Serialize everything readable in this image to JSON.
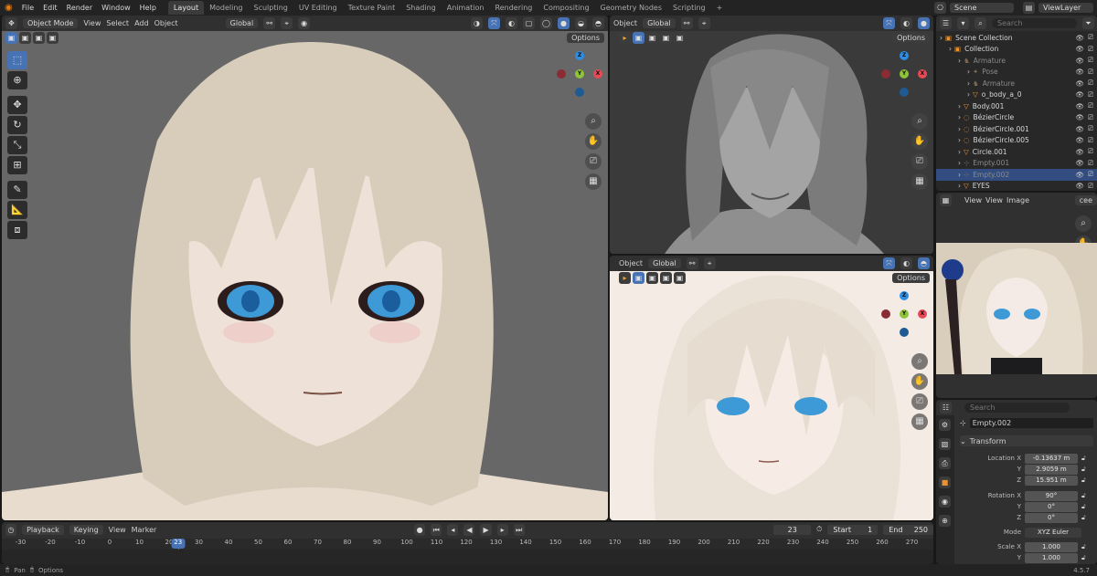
{
  "topbar": {
    "menus": [
      "File",
      "Edit",
      "Render",
      "Window",
      "Help"
    ],
    "workspaces": [
      "Layout",
      "Modeling",
      "Sculpting",
      "UV Editing",
      "Texture Paint",
      "Shading",
      "Animation",
      "Rendering",
      "Compositing",
      "Geometry Nodes",
      "Scripting"
    ],
    "add_tab": "+",
    "scene": "Scene",
    "view_layer": "ViewLayer"
  },
  "main_viewport": {
    "mode": "Object Mode",
    "menus": [
      "View",
      "Select",
      "Add",
      "Object"
    ],
    "orientation": "Global",
    "options": "Options"
  },
  "top_right_viewport": {
    "menu": "Object",
    "orientation": "Global",
    "options": "Options"
  },
  "bottom_right_viewport": {
    "menu": "Object",
    "orientation": "Global",
    "options": "Options"
  },
  "gizmo": {
    "x": "X",
    "y": "Y",
    "z": "Z"
  },
  "outliner": {
    "search_placeholder": "Search",
    "rows": [
      {
        "label": "Scene Collection",
        "indent": 0,
        "icon": "▣",
        "dim": false,
        "sel": false
      },
      {
        "label": "Collection",
        "indent": 1,
        "icon": "▣",
        "dim": false,
        "sel": false
      },
      {
        "label": "Armature",
        "indent": 2,
        "icon": "♞",
        "dim": true,
        "sel": false
      },
      {
        "label": "Pose",
        "indent": 3,
        "icon": "✦",
        "dim": true,
        "sel": false
      },
      {
        "label": "Armature",
        "indent": 3,
        "icon": "♞",
        "dim": true,
        "sel": false
      },
      {
        "label": "o_body_a_0",
        "indent": 3,
        "icon": "▽",
        "dim": false,
        "sel": false
      },
      {
        "label": "Body.001",
        "indent": 2,
        "icon": "▽",
        "dim": false,
        "sel": false
      },
      {
        "label": "BézierCircle",
        "indent": 2,
        "icon": "◌",
        "dim": false,
        "sel": false
      },
      {
        "label": "BézierCircle.001",
        "indent": 2,
        "icon": "◌",
        "dim": false,
        "sel": false
      },
      {
        "label": "BézierCircle.005",
        "indent": 2,
        "icon": "◌",
        "dim": false,
        "sel": false
      },
      {
        "label": "Circle.001",
        "indent": 2,
        "icon": "▽",
        "dim": false,
        "sel": false
      },
      {
        "label": "Empty.001",
        "indent": 2,
        "icon": "⊹",
        "dim": true,
        "sel": false
      },
      {
        "label": "Empty.002",
        "indent": 2,
        "icon": "⊹",
        "dim": true,
        "sel": true
      },
      {
        "label": "EYES",
        "indent": 2,
        "icon": "▽",
        "dim": false,
        "sel": false
      }
    ]
  },
  "image_editor": {
    "menus": [
      "View",
      "View",
      "Image"
    ],
    "tab": "cee"
  },
  "properties": {
    "search_placeholder": "Search",
    "object": "Empty.002",
    "panel": "Transform",
    "location": {
      "label": "Location",
      "x": "-0.13637 m",
      "y": "2.9059 m",
      "z": "15.951 m"
    },
    "rotation": {
      "label": "Rotation",
      "x": "90°",
      "y": "0°",
      "z": "0°"
    },
    "mode": {
      "label": "Mode",
      "value": "XYZ Euler"
    },
    "scale": {
      "label": "Scale",
      "x": "1.000",
      "y": "1.000"
    },
    "axis": {
      "x": "X",
      "y": "Y",
      "z": "Z"
    }
  },
  "timeline": {
    "menus": [
      "Playback",
      "Keying",
      "View",
      "Marker"
    ],
    "current_frame": "23",
    "start_label": "Start",
    "start": "1",
    "end_label": "End",
    "end": "250",
    "ticks": [
      "-30",
      "-20",
      "-10",
      "0",
      "10",
      "20",
      "30",
      "40",
      "50",
      "60",
      "70",
      "80",
      "90",
      "100",
      "110",
      "120",
      "130",
      "140",
      "150",
      "160",
      "170",
      "180",
      "190",
      "200",
      "210",
      "220",
      "230",
      "240",
      "250",
      "260",
      "270"
    ],
    "playhead": "23"
  },
  "statusbar": {
    "pan": "Pan",
    "options": "Options",
    "version": "4.5.7"
  },
  "colors": {
    "accent": "#4772b3",
    "x_axis": "#e84a55",
    "y_axis": "#8ec43a",
    "z_axis": "#2d8de3"
  }
}
